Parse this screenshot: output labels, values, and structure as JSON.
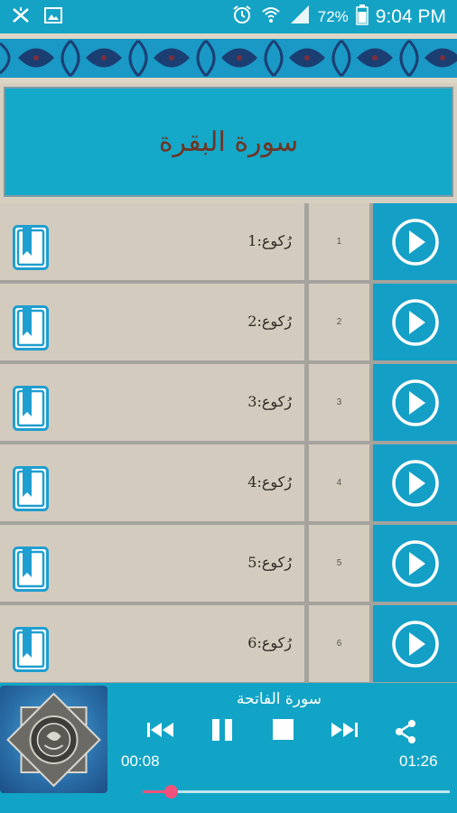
{
  "status_bar": {
    "battery_percent": "72%",
    "time": "9:04 PM",
    "icons": [
      "app-notification-icon",
      "image-notification-icon",
      "alarm-icon",
      "wifi-icon",
      "signal-icon",
      "battery-icon"
    ]
  },
  "title": "سورة البقرة",
  "rows": [
    {
      "label": "رُکوع:1",
      "number": "1"
    },
    {
      "label": "رُکوع:2",
      "number": "2"
    },
    {
      "label": "رُکوع:3",
      "number": "3"
    },
    {
      "label": "رُکوع:4",
      "number": "4"
    },
    {
      "label": "رُکوع:5",
      "number": "5"
    },
    {
      "label": "رُکوع:6",
      "number": "6"
    }
  ],
  "player": {
    "track_title": "سورة الفاتحة",
    "current_time": "00:08",
    "total_time": "01:26",
    "progress": 0.09
  },
  "colors": {
    "accent": "#14a3c5",
    "title_text": "#6e3524",
    "seek": "#f2517b"
  }
}
